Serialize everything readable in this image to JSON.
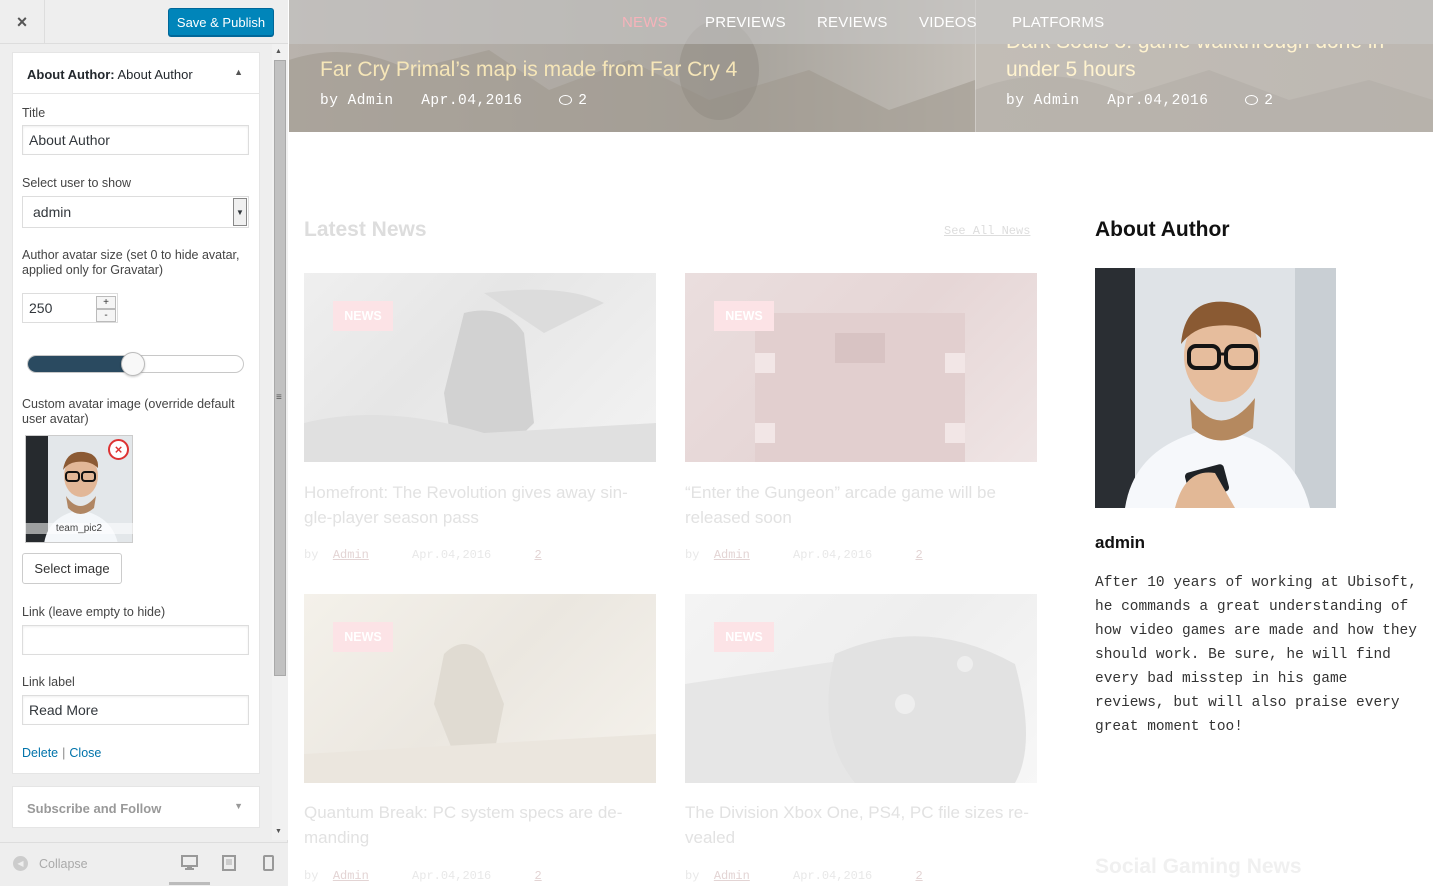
{
  "panel": {
    "close_label": "×",
    "save_label": "Save & Publish",
    "widget": {
      "title_bold": "About Author:",
      "title_rest": " About Author",
      "title_label": "Title",
      "title_value": "About Author",
      "user_label": "Select user to show",
      "user_value": "admin",
      "avatar_size_label": "Author avatar size (set 0 to hide avatar, applied only for Gravatar)",
      "avatar_size_value": "250",
      "slider_fraction": 0.49,
      "custom_avatar_label": "Custom avatar image (override default user avatar)",
      "image_filename": "team_pic2",
      "select_image_label": "Select image",
      "link_label": "Link (leave empty to hide)",
      "link_value": "",
      "link_text_label": "Link label",
      "link_text_value": "Read More",
      "delete_label": "Delete",
      "separator": "|",
      "close_link_label": "Close"
    },
    "widget2_title": "Subscribe and Follow",
    "collapse_label": "Collapse"
  },
  "preview": {
    "nav": [
      "NEWS",
      "PREVIEWS",
      "REVIEWS",
      "VIDEOS",
      "PLATFORMS"
    ],
    "hero": [
      {
        "title": "Far Cry Primal’s map is made from Far Cry 4",
        "by": "by Admin",
        "date": "Apr.04,2016",
        "comments": "2"
      },
      {
        "title_top": "Dark Souls 3: game walkthrough done in",
        "title": "under 5 hours",
        "by": "by Admin",
        "date": "Apr.04,2016",
        "comments": "2"
      }
    ],
    "latest_title": "Latest News",
    "see_all": "See All News",
    "cards": [
      {
        "tag": "NEWS",
        "title1": "Homefront: The Revolution gives away sin-",
        "title2": "gle-player season pass",
        "by": "by",
        "author": "Admin",
        "date": "Apr.04,2016",
        "comments": "2"
      },
      {
        "tag": "NEWS",
        "title1": "“Enter the Gungeon” arcade game will be",
        "title2": "released soon",
        "by": "by",
        "author": "Admin",
        "date": "Apr.04,2016",
        "comments": "2"
      },
      {
        "tag": "NEWS",
        "title1": "Quantum Break: PC system specs are de-",
        "title2": "manding",
        "by": "by",
        "author": "Admin",
        "date": "Apr.04,2016",
        "comments": "2"
      },
      {
        "tag": "NEWS",
        "title1": "The Division Xbox One, PS4, PC file sizes re-",
        "title2": "vealed",
        "by": "by",
        "author": "Admin",
        "date": "Apr.04,2016",
        "comments": "2"
      }
    ],
    "about": {
      "title": "About Author",
      "name": "admin",
      "bio": "After 10 years of working at Ubisoft, he commands a great un­derstanding of how video games are made and how they should work. Be sure, he will find every bad misstep in his game reviews, but will also praise every great moment too!"
    },
    "social_title": "Social Gaming News"
  },
  "colors": {
    "accent": "#0085ba",
    "link": "#0073aa",
    "nav_active": "#f6b3ba",
    "tag": "#fce3e6"
  },
  "icons": [
    "close-icon",
    "collapse-arrow-icon",
    "dropdown-arrow-icon",
    "remove-icon",
    "chat-icon",
    "desktop-icon",
    "tablet-icon",
    "mobile-icon"
  ]
}
